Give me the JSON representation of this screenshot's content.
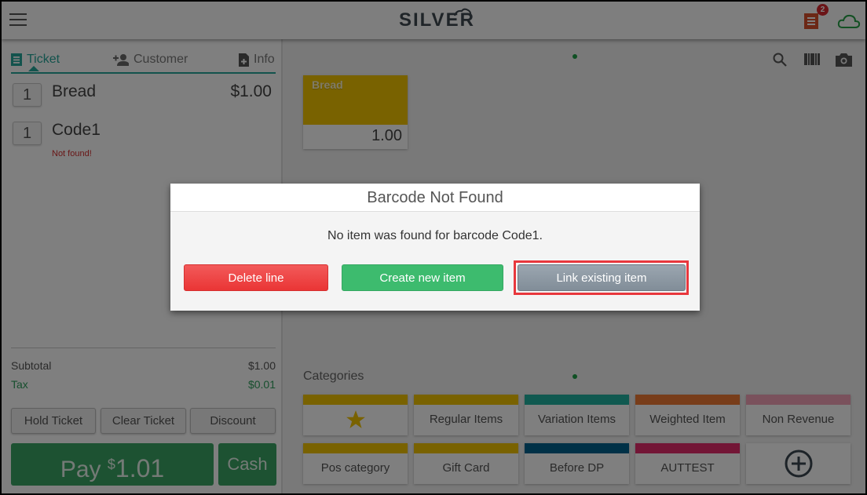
{
  "header": {
    "logo": "SILVER",
    "notification_count": "2"
  },
  "left_panel": {
    "tabs": [
      {
        "label": "Ticket",
        "icon": "receipt-icon",
        "active": true
      },
      {
        "label": "Customer",
        "icon": "add-person-icon",
        "active": false
      },
      {
        "label": "Info",
        "icon": "add-document-icon",
        "active": false
      }
    ],
    "lines": [
      {
        "qty": "1",
        "name": "Bread",
        "price": "$1.00",
        "error": ""
      },
      {
        "qty": "1",
        "name": "Code1",
        "price": "",
        "error": "Not found!"
      }
    ],
    "subtotal_label": "Subtotal",
    "subtotal_value": "$1.00",
    "tax_label": "Tax",
    "tax_value": "$0.01",
    "actions": {
      "hold": "Hold Ticket",
      "clear": "Clear Ticket",
      "discount": "Discount"
    },
    "pay": {
      "label": "Pay",
      "currency": "$",
      "amount": "1.01"
    },
    "cash_label": "Cash"
  },
  "right_panel": {
    "toolbar_icons": [
      "search-icon",
      "barcode-icon",
      "camera-icon"
    ],
    "items": [
      {
        "name": "Bread",
        "price": "1.00",
        "color": "#f2c500"
      }
    ],
    "categories_label": "Categories",
    "categories": [
      {
        "label": "",
        "icon": "star-icon",
        "color": "#f2c500"
      },
      {
        "label": "Regular Items",
        "color": "#f2c500"
      },
      {
        "label": "Variation Items",
        "color": "#20b2a0"
      },
      {
        "label": "Weighted Item",
        "color": "#f07a35"
      },
      {
        "label": "Non Revenue",
        "color": "#f5a3b8"
      },
      {
        "label": "Pos category",
        "color": "#f2c500"
      },
      {
        "label": "Gift Card",
        "color": "#f2c500"
      },
      {
        "label": "Before DP",
        "color": "#00628f"
      },
      {
        "label": "AUTTEST",
        "color": "#e62c6d"
      },
      {
        "label": "",
        "icon": "add-circle-icon",
        "color": ""
      }
    ]
  },
  "dialog": {
    "title": "Barcode Not Found",
    "message": "No item was found for barcode Code1.",
    "buttons": {
      "delete": "Delete line",
      "create": "Create new item",
      "link": "Link existing item"
    }
  }
}
